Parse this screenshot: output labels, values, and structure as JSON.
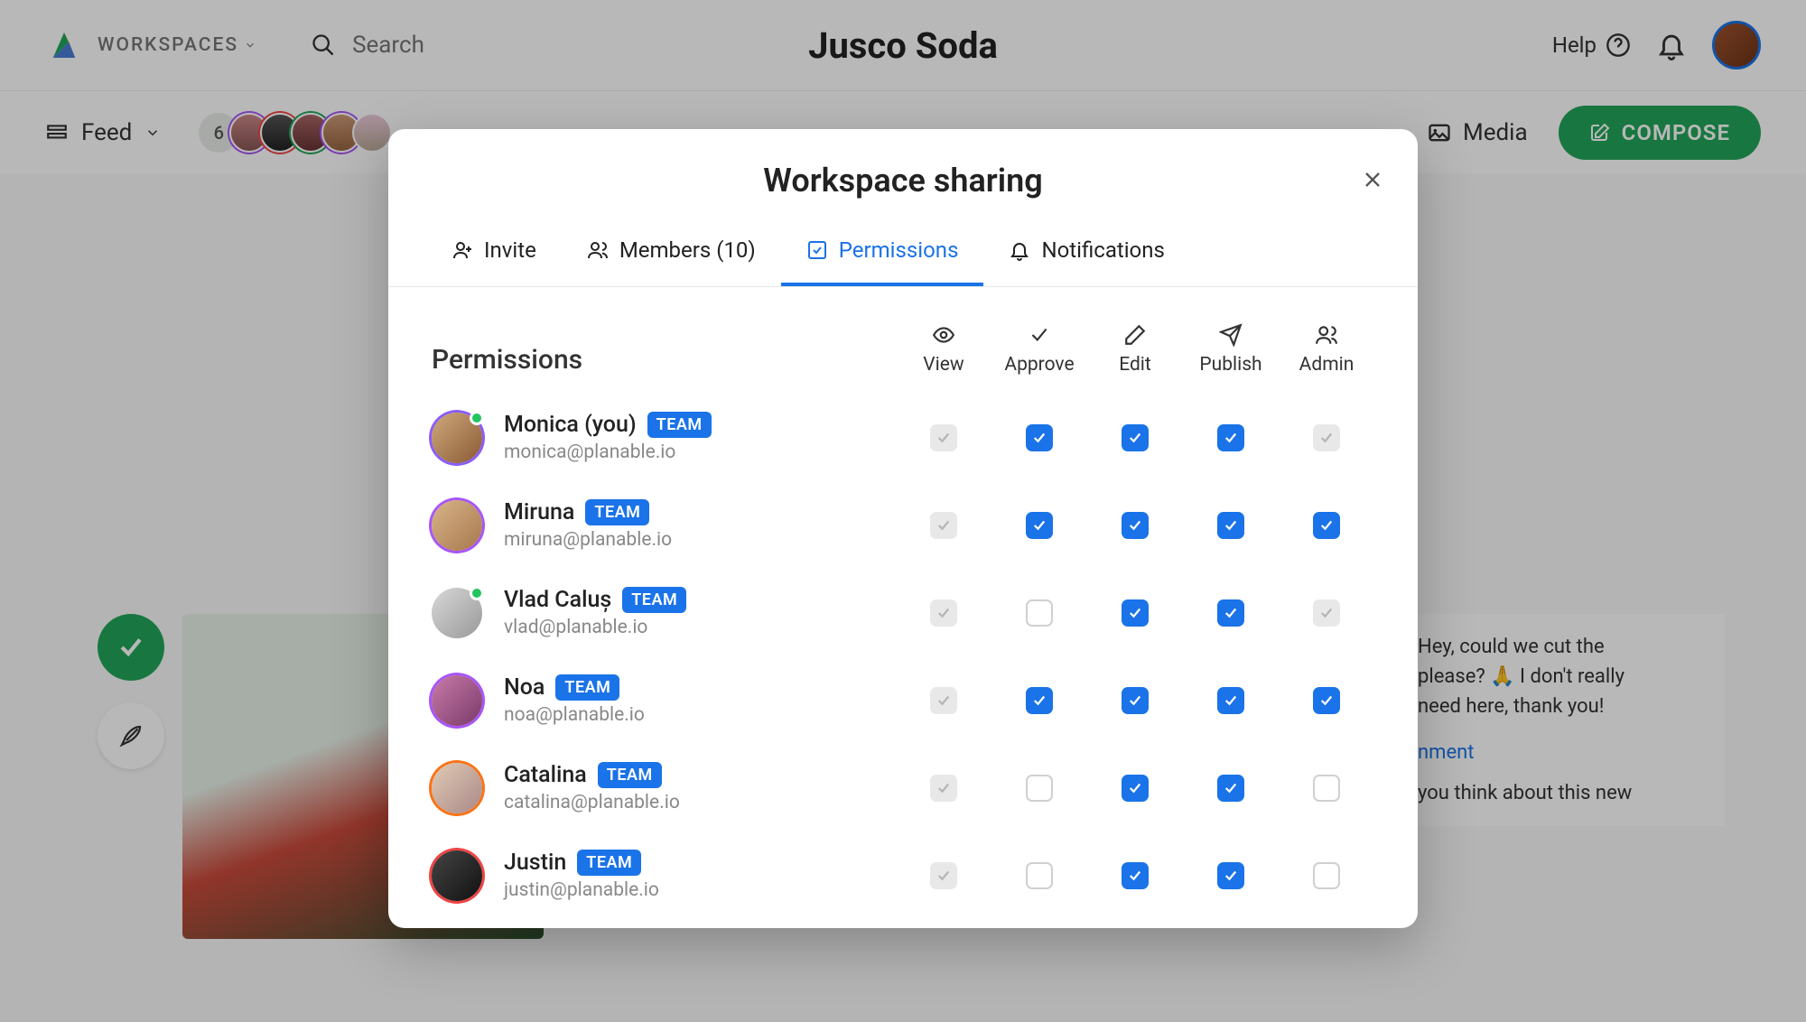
{
  "header": {
    "workspaces_label": "WORKSPACES",
    "search_placeholder": "Search",
    "title": "Jusco Soda",
    "help_label": "Help"
  },
  "secondary": {
    "feed_label": "Feed",
    "member_count": "6",
    "media_label": "Media",
    "compose_label": "COMPOSE"
  },
  "comments": {
    "line1": "Hey, could we cut the",
    "line2": "please? 🙏 I don't really",
    "line3": "need here, thank you!",
    "link_fragment": "nment",
    "line4": "you think about this new"
  },
  "modal": {
    "title": "Workspace sharing",
    "tabs": {
      "invite": "Invite",
      "members": "Members (10)",
      "permissions": "Permissions",
      "notifications": "Notifications"
    },
    "section_title": "Permissions",
    "columns": [
      "View",
      "Approve",
      "Edit",
      "Publish",
      "Admin"
    ],
    "team_badge": "TEAM",
    "members": [
      {
        "name": "Monica (you)",
        "email": "monica@planable.io",
        "presence": true,
        "ring": "ring-purple",
        "avatar_bg": "linear-gradient(135deg,#cfa97b,#8a5a35)",
        "perms": [
          "locked",
          "on",
          "on",
          "on",
          "locked"
        ]
      },
      {
        "name": "Miruna",
        "email": "miruna@planable.io",
        "presence": false,
        "ring": "ring-violet",
        "avatar_bg": "linear-gradient(135deg,#d9b48a,#a7784d)",
        "perms": [
          "locked",
          "on",
          "on",
          "on",
          "on"
        ]
      },
      {
        "name": "Vlad Caluș",
        "email": "vlad@planable.io",
        "presence": true,
        "ring": "",
        "avatar_bg": "linear-gradient(135deg,#d8d8d8,#999)",
        "perms": [
          "locked",
          "off",
          "on",
          "on",
          "locked"
        ]
      },
      {
        "name": "Noa",
        "email": "noa@planable.io",
        "presence": false,
        "ring": "ring-violet",
        "avatar_bg": "linear-gradient(135deg,#c97ba8,#7a3a6a)",
        "perms": [
          "locked",
          "on",
          "on",
          "on",
          "on"
        ]
      },
      {
        "name": "Catalina",
        "email": "catalina@planable.io",
        "presence": false,
        "ring": "ring-orange",
        "avatar_bg": "linear-gradient(135deg,#e0cbb5,#a88)",
        "perms": [
          "locked",
          "off",
          "on",
          "on",
          "off"
        ]
      },
      {
        "name": "Justin",
        "email": "justin@planable.io",
        "presence": false,
        "ring": "ring-red",
        "avatar_bg": "linear-gradient(135deg,#444,#111)",
        "perms": [
          "locked",
          "off",
          "on",
          "on",
          "off"
        ]
      }
    ]
  }
}
